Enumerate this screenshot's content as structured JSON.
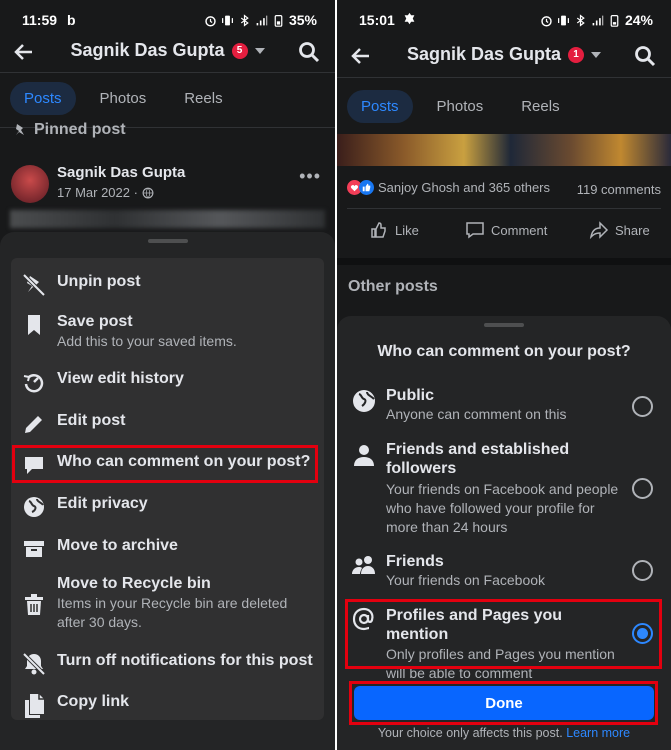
{
  "left": {
    "status": {
      "time": "11:59",
      "extra": "b",
      "battery": "35%"
    },
    "header": {
      "title": "Sagnik Das Gupta",
      "badge": "5"
    },
    "tabs": [
      "Posts",
      "Photos",
      "Reels"
    ],
    "pinned_label": "Pinned post",
    "post": {
      "author": "Sagnik Das Gupta",
      "date": "17 Mar 2022 ·"
    },
    "menu": [
      {
        "icon": "unpin-icon",
        "title": "Unpin post",
        "subtitle": ""
      },
      {
        "icon": "bookmark-icon",
        "title": "Save post",
        "subtitle": "Add this to your saved items."
      },
      {
        "icon": "history-icon",
        "title": "View edit history",
        "subtitle": ""
      },
      {
        "icon": "pencil-icon",
        "title": "Edit post",
        "subtitle": ""
      },
      {
        "icon": "comment-bubble-icon",
        "title": "Who can comment on your post?",
        "subtitle": ""
      },
      {
        "icon": "globe-icon",
        "title": "Edit privacy",
        "subtitle": ""
      },
      {
        "icon": "archive-icon",
        "title": "Move to archive",
        "subtitle": ""
      },
      {
        "icon": "trash-icon",
        "title": "Move to Recycle bin",
        "subtitle": "Items in your Recycle bin are deleted after 30 days."
      },
      {
        "icon": "bell-off-icon",
        "title": "Turn off notifications for this post",
        "subtitle": ""
      },
      {
        "icon": "copy-icon",
        "title": "Copy link",
        "subtitle": ""
      }
    ]
  },
  "right": {
    "status": {
      "time": "15:01",
      "battery": "24%"
    },
    "header": {
      "title": "Sagnik Das Gupta",
      "badge": "1"
    },
    "tabs": [
      "Posts",
      "Photos",
      "Reels"
    ],
    "reactions": {
      "text": "Sanjoy Ghosh and 365 others",
      "comments": "119 comments"
    },
    "actions": [
      "Like",
      "Comment",
      "Share"
    ],
    "other_posts": "Other posts",
    "sheet": {
      "title": "Who can comment on your post?",
      "options": [
        {
          "icon": "globe-icon",
          "title": "Public",
          "subtitle": "Anyone can comment on this",
          "selected": false
        },
        {
          "icon": "person-icon",
          "title": "Friends and established followers",
          "subtitle": "Your friends on Facebook and people who have followed your profile for more than 24 hours",
          "selected": false
        },
        {
          "icon": "friends-icon",
          "title": "Friends",
          "subtitle": "Your friends on Facebook",
          "selected": false
        },
        {
          "icon": "at-sign-icon",
          "title": "Profiles and Pages you mention",
          "subtitle": "Only profiles and Pages you mention will be able to comment",
          "selected": true
        }
      ],
      "done": "Done",
      "note": "Your choice only affects this post.",
      "learn_more": "Learn more"
    }
  },
  "colors": {
    "background": "#18191a",
    "sheet": "#242526",
    "accent": "#2d88ff",
    "button": "#0866ff",
    "highlight": "#e3000f"
  }
}
